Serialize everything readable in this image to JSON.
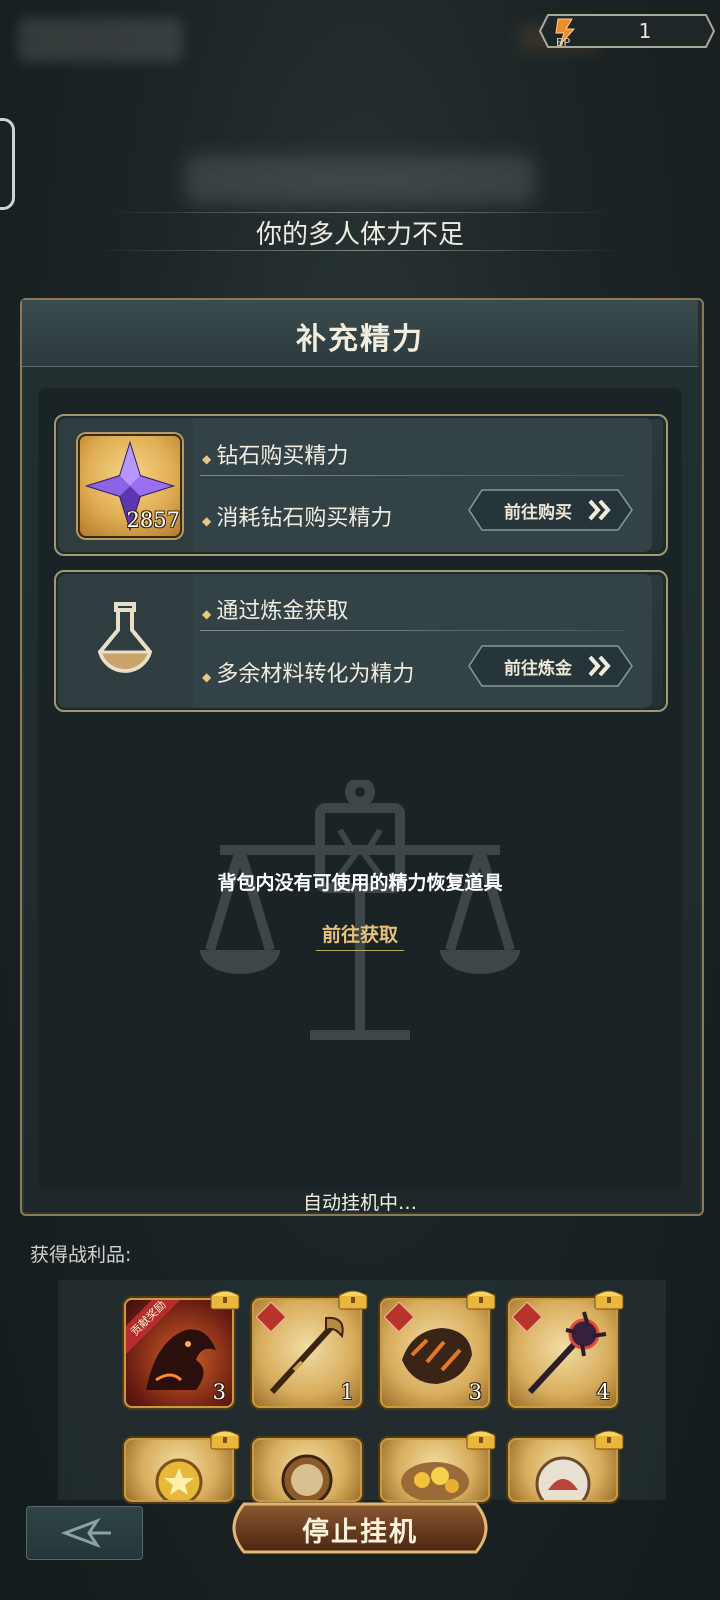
{
  "top_bar": {
    "bp_label": "BP",
    "bp_value": "1"
  },
  "notice": "你的多人体力不足",
  "panel": {
    "title": "补充精力",
    "options": [
      {
        "item_count": "2857",
        "title": "钻石购买精力",
        "desc": "消耗钻石购买精力",
        "button": "前往购买",
        "icon": "purple-crystal-icon"
      },
      {
        "title": "通过炼金获取",
        "desc": "多余材料转化为精力",
        "button": "前往炼金",
        "icon": "flask-icon"
      }
    ],
    "empty_bag_text": "背包内没有可使用的精力恢复道具",
    "get_link": "前往获取"
  },
  "auto_status": "自动挂机中…",
  "loot": {
    "label": "获得战利品:",
    "items": [
      {
        "icon": "dragon-icon",
        "badge": "贡献奖励",
        "count": "3"
      },
      {
        "icon": "staff-weapon-icon",
        "count": "1"
      },
      {
        "icon": "gauntlet-icon",
        "count": "3"
      },
      {
        "icon": "spiked-scepter-icon",
        "count": "4"
      },
      {
        "icon": "star-medal-icon",
        "count": ""
      },
      {
        "icon": "compass-icon",
        "count": ""
      },
      {
        "icon": "gold-ore-icon",
        "count": ""
      },
      {
        "icon": "monster-orb-icon",
        "count": ""
      }
    ]
  },
  "stop_button": "停止挂机",
  "colors": {
    "accent_gold": "#e7c17b",
    "panel_border": "#8c7a56",
    "badge_red": "#b52d2d"
  }
}
